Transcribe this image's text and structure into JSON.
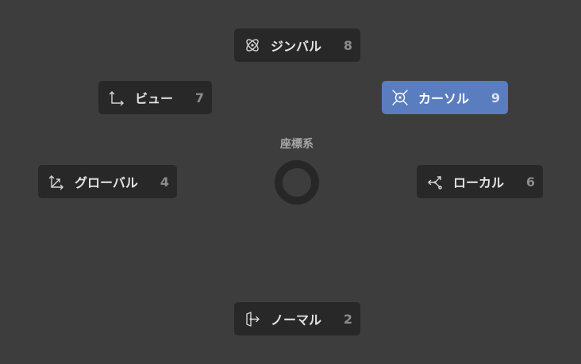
{
  "pie_menu": {
    "title": "座標系",
    "items": [
      {
        "id": "gimbal",
        "label": "ジンバル",
        "shortcut": "8",
        "icon": "gimbal-icon",
        "active": false
      },
      {
        "id": "view",
        "label": "ビュー",
        "shortcut": "7",
        "icon": "view-orientation-icon",
        "active": false
      },
      {
        "id": "cursor",
        "label": "カーソル",
        "shortcut": "9",
        "icon": "cursor-icon",
        "active": true
      },
      {
        "id": "global",
        "label": "グローバル",
        "shortcut": "4",
        "icon": "global-axes-icon",
        "active": false
      },
      {
        "id": "local",
        "label": "ローカル",
        "shortcut": "6",
        "icon": "local-axes-icon",
        "active": false
      },
      {
        "id": "normal",
        "label": "ノーマル",
        "shortcut": "2",
        "icon": "normal-icon",
        "active": false
      }
    ]
  },
  "colors": {
    "background": "#3d3d3d",
    "item_background": "#282828",
    "active_item_background": "#5a7dbf",
    "ring": "#272727"
  }
}
